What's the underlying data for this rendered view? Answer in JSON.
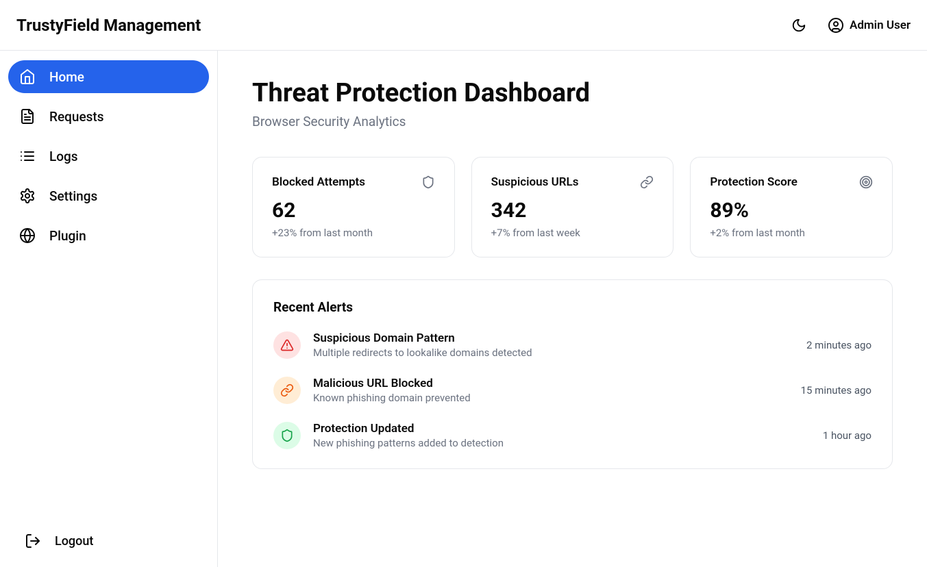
{
  "app_title": "TrustyField Management",
  "header": {
    "user_label": "Admin User"
  },
  "sidebar": {
    "items": [
      {
        "label": "Home",
        "icon": "home",
        "active": true
      },
      {
        "label": "Requests",
        "icon": "file",
        "active": false
      },
      {
        "label": "Logs",
        "icon": "list",
        "active": false
      },
      {
        "label": "Settings",
        "icon": "gear",
        "active": false
      },
      {
        "label": "Plugin",
        "icon": "globe",
        "active": false
      }
    ],
    "logout_label": "Logout"
  },
  "page": {
    "title": "Threat Protection Dashboard",
    "subtitle": "Browser Security Analytics"
  },
  "stats": [
    {
      "label": "Blocked Attempts",
      "value": "62",
      "change": "+23% from last month",
      "icon": "shield"
    },
    {
      "label": "Suspicious URLs",
      "value": "342",
      "change": "+7% from last week",
      "icon": "link"
    },
    {
      "label": "Protection Score",
      "value": "89%",
      "change": "+2% from last month",
      "icon": "target"
    }
  ],
  "alerts": {
    "title": "Recent Alerts",
    "items": [
      {
        "title": "Suspicious Domain Pattern",
        "desc": "Multiple redirects to lookalike domains detected",
        "time": "2 minutes ago",
        "color": "red",
        "icon": "warning"
      },
      {
        "title": "Malicious URL Blocked",
        "desc": "Known phishing domain prevented",
        "time": "15 minutes ago",
        "color": "orange",
        "icon": "link"
      },
      {
        "title": "Protection Updated",
        "desc": "New phishing patterns added to detection",
        "time": "1 hour ago",
        "color": "green",
        "icon": "shield"
      }
    ]
  }
}
